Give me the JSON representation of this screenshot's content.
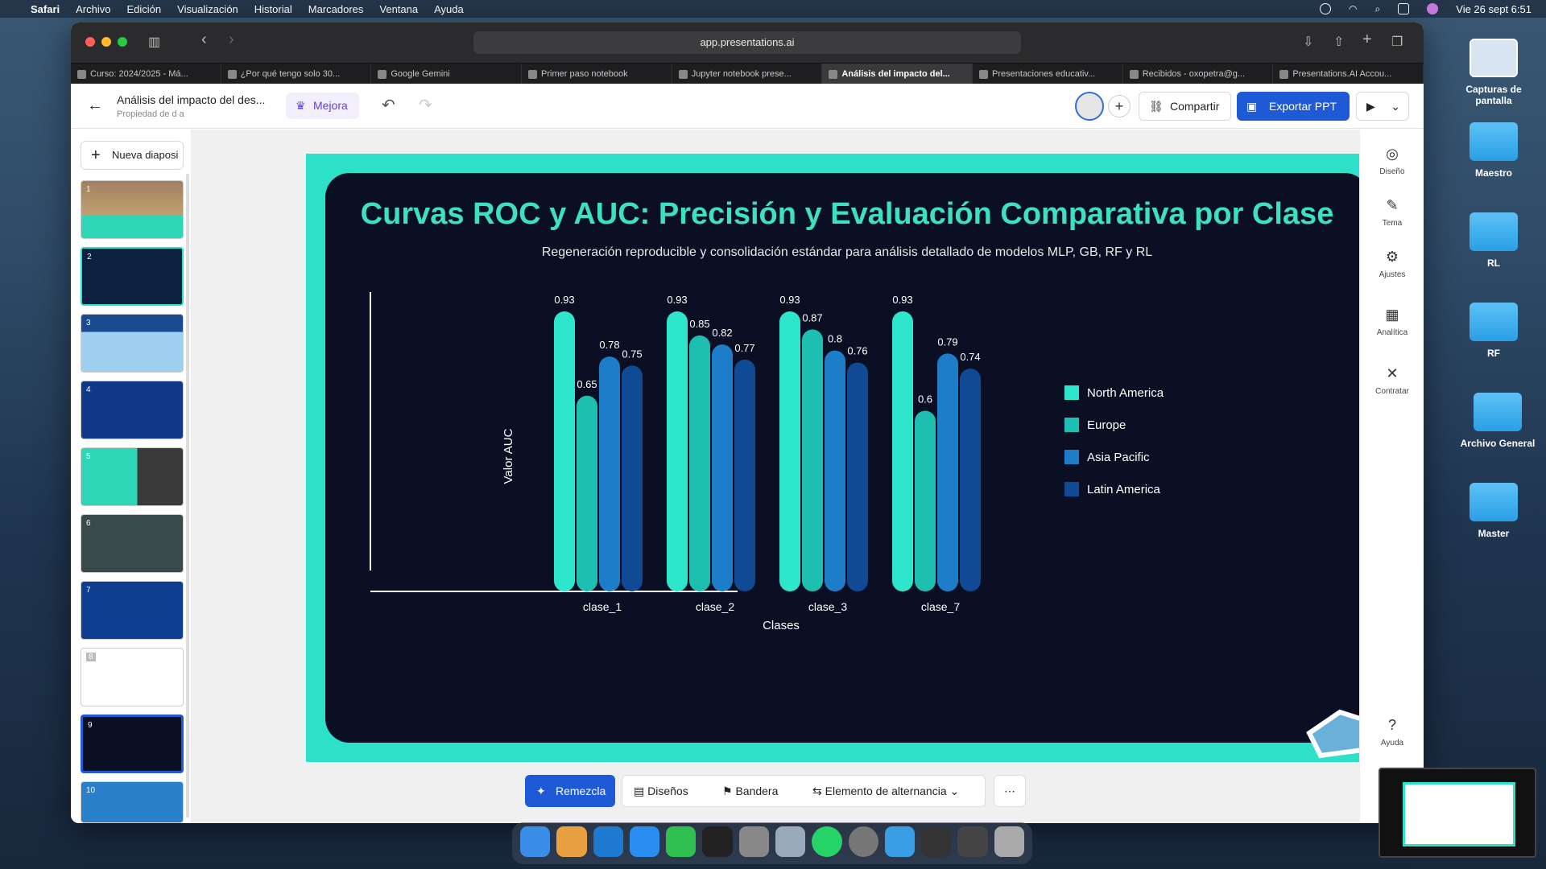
{
  "menubar": {
    "app": "Safari",
    "items": [
      "Archivo",
      "Edición",
      "Visualización",
      "Historial",
      "Marcadores",
      "Ventana",
      "Ayuda"
    ],
    "datetime": "Vie 26 sept 6:51"
  },
  "browser": {
    "url": "app.presentations.ai",
    "tabs": [
      "Curso: 2024/2025 - Má...",
      "¿Por qué tengo solo 30...",
      "Google Gemini",
      "Primer paso notebook",
      "Jupyter notebook prese...",
      "Análisis del impacto del...",
      "Presentaciones educativ...",
      "Recibidos - oxopetra@g...",
      "Presentations.AI Accou..."
    ],
    "active_tab": 5
  },
  "app": {
    "doc_title": "Análisis del impacto del des...",
    "doc_sub": "Propiedad de d a",
    "mejora": "Mejora",
    "share": "Compartir",
    "export": "Exportar PPT",
    "new_slide": "Nueva diaposi"
  },
  "thumbs": [
    "1",
    "2",
    "3",
    "4",
    "5",
    "6",
    "7",
    "8",
    "9",
    "10"
  ],
  "slide": {
    "title": "Curvas ROC y AUC: Precisión y Evaluación Comparativa por Clase",
    "subtitle": "Regeneración reproducible y consolidación estándar para análisis detallado de modelos MLP, GB, RF y RL"
  },
  "chart_data": {
    "type": "bar",
    "categories": [
      "clase_1",
      "clase_2",
      "clase_3",
      "clase_7"
    ],
    "series": [
      {
        "name": "North America",
        "values": [
          0.93,
          0.93,
          0.93,
          0.93
        ],
        "color": "#2ee6cc"
      },
      {
        "name": "Europe",
        "values": [
          0.65,
          0.85,
          0.87,
          0.6
        ],
        "color": "#1cbfb0"
      },
      {
        "name": "Asia Pacific",
        "values": [
          0.78,
          0.82,
          0.8,
          0.79
        ],
        "color": "#1e7dc8"
      },
      {
        "name": "Latin America",
        "values": [
          0.75,
          0.77,
          0.76,
          0.74
        ],
        "color": "#104a94"
      }
    ],
    "xlabel": "Clases",
    "ylabel": "Valor AUC",
    "ylim": [
      0,
      1
    ],
    "legend": "right"
  },
  "right_panel": [
    "Diseño",
    "Tema",
    "Ajustes",
    "Analítica",
    "Contratar",
    "Ayuda"
  ],
  "bottom_bar": {
    "remix": "Remezcla",
    "designs": "Diseños",
    "flag": "Bandera",
    "toggle": "Elemento de alternancia"
  },
  "desktop": [
    "Capturas de pantalla",
    "Maestro",
    "RL",
    "RF",
    "Archivo General",
    "Master"
  ]
}
